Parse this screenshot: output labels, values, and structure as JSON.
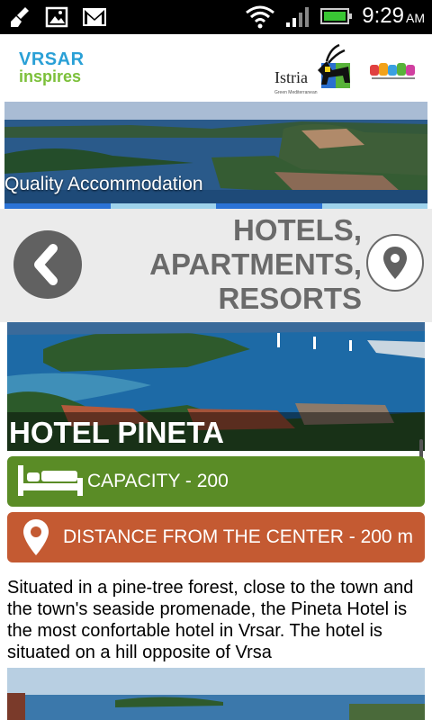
{
  "status_bar": {
    "time": "9:29",
    "ampm": "AM"
  },
  "header": {
    "vrsar_logo_top": "VRSAR",
    "vrsar_logo_bottom": "inspires",
    "istria_logo_text": "Istria",
    "istria_logo_sub": "Green Mediterranean"
  },
  "banner": {
    "caption": "Quality Accommodation",
    "bar_colors": [
      "#2b73d6",
      "#9fd3ec",
      "#2b73d6",
      "#9fd3ec"
    ]
  },
  "page": {
    "title_line1": "HOTELS,",
    "title_line2": "APARTMENTS,",
    "title_line3": "RESORTS"
  },
  "hotel": {
    "name": "HOTEL PINETA",
    "capacity": "CAPACITY - 200",
    "distance": "DISTANCE FROM THE CENTER - 200 m",
    "description": "Situated in a pine-tree forest, close to the town and the town's seaside promenade, the Pineta Hotel is the most confortable hotel in Vrsar. The hotel is situated on a hill opposite of Vrsa"
  },
  "icons": {
    "back": "chevron-left-icon",
    "map": "map-pin-icon",
    "capacity": "bed-icon",
    "distance": "map-pin-icon"
  },
  "colors": {
    "capacity_bg": "#5a8c26",
    "distance_bg": "#c45a32",
    "title_gray": "#6a6a6a"
  }
}
